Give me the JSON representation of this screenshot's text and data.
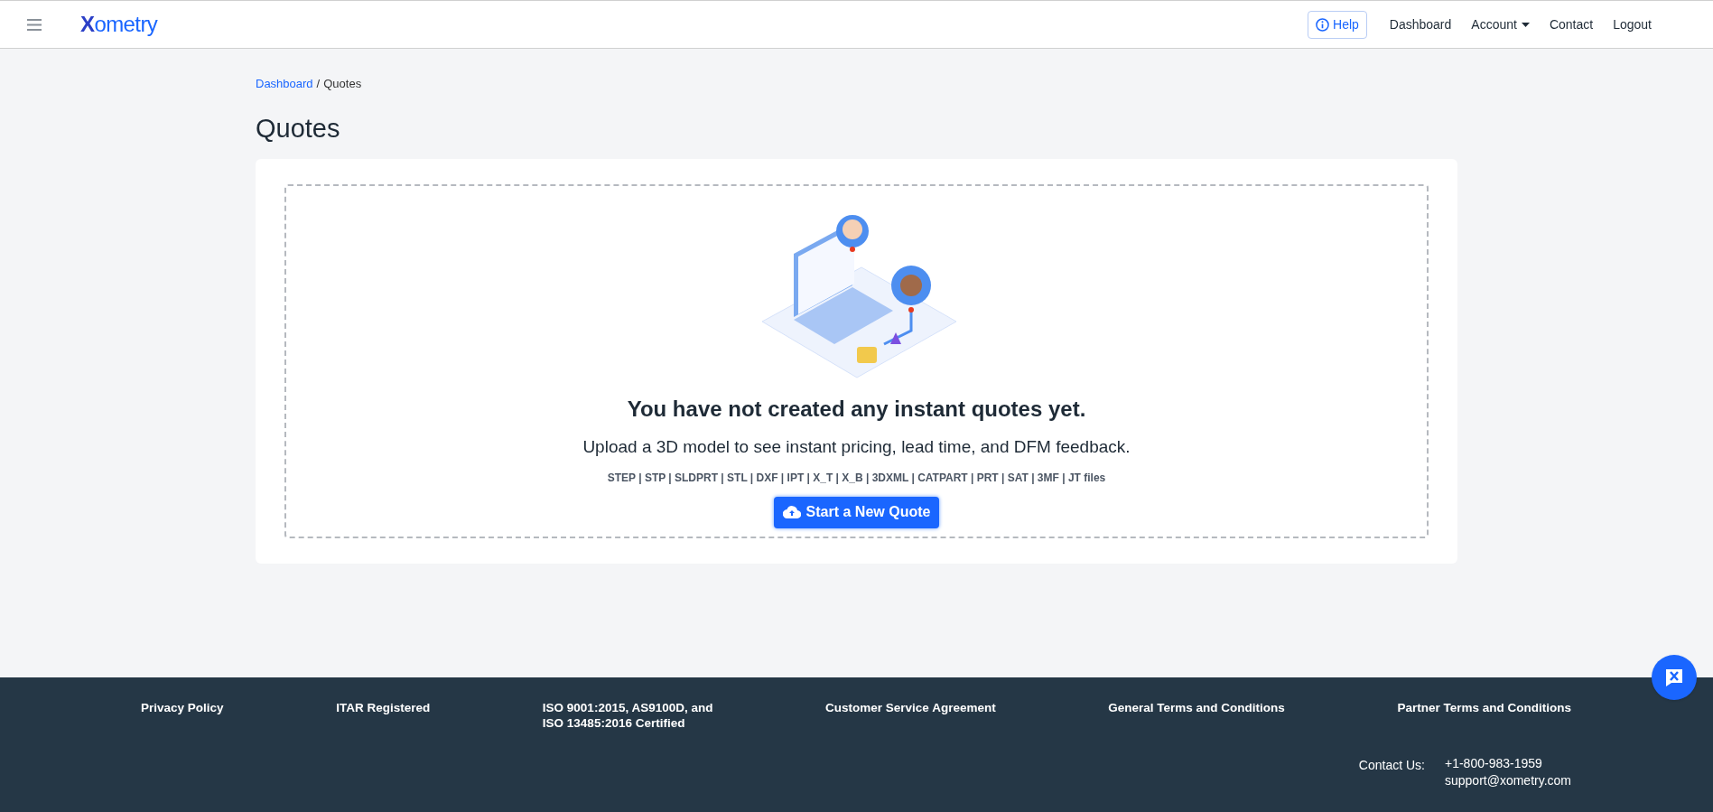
{
  "header": {
    "logo": "Xometry",
    "nav": [
      {
        "kind": "help",
        "label": "Help"
      },
      {
        "kind": "link",
        "label": "Dashboard"
      },
      {
        "kind": "dropdown",
        "label": "Account"
      },
      {
        "kind": "link",
        "label": "Contact"
      },
      {
        "kind": "link",
        "label": "Logout"
      }
    ]
  },
  "breadcrumb": {
    "link": "Dashboard",
    "separator": "/",
    "current": "Quotes"
  },
  "page_title": "Quotes",
  "empty_state": {
    "heading": "You have not created any instant quotes yet.",
    "subtitle": "Upload a 3D model to see instant pricing, lead time, and DFM feedback.",
    "formats": "STEP | STP | SLDPRT | STL | DXF | IPT | X_T | X_B | 3DXML | CATPART | PRT | SAT | 3MF | JT files",
    "button": "Start a New Quote"
  },
  "footer": {
    "links": [
      [
        "Privacy Policy"
      ],
      [
        "ITAR Registered"
      ],
      [
        "ISO 9001:2015, AS9100D, and",
        "ISO 13485:2016 Certified"
      ],
      [
        "Customer Service Agreement"
      ],
      [
        "General Terms and Conditions"
      ],
      [
        "Partner Terms and Conditions"
      ]
    ],
    "contact_label": "Contact Us:",
    "phone": "+1-800-983-1959",
    "email": "support@xometry.com"
  }
}
